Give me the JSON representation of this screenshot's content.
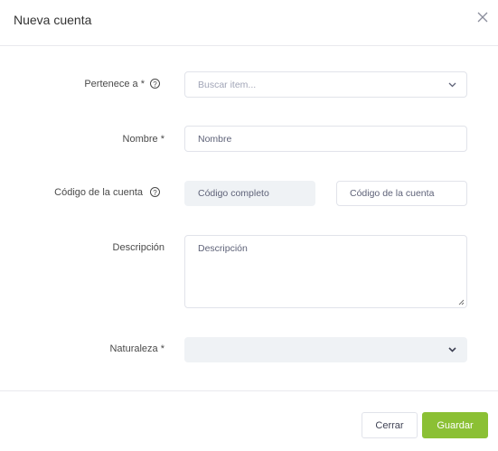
{
  "modal": {
    "title": "Nueva cuenta",
    "close_icon": "close-icon"
  },
  "form": {
    "pertenece": {
      "label": "Pertenece a *",
      "placeholder": "Buscar item...",
      "help_icon": "help-circle-icon"
    },
    "nombre": {
      "label": "Nombre *",
      "placeholder": "Nombre"
    },
    "codigo": {
      "label": "Código de la cuenta",
      "help_icon": "help-circle-icon",
      "full_placeholder": "Código completo",
      "code_placeholder": "Código de la cuenta"
    },
    "descripcion": {
      "label": "Descripción",
      "placeholder": "Descripción"
    },
    "naturaleza": {
      "label": "Naturaleza *",
      "value": ""
    }
  },
  "footer": {
    "cancel_label": "Cerrar",
    "save_label": "Guardar"
  },
  "colors": {
    "accent": "#8bc034",
    "input_border": "#e1e3ea",
    "disabled_bg": "#eff2f5"
  }
}
